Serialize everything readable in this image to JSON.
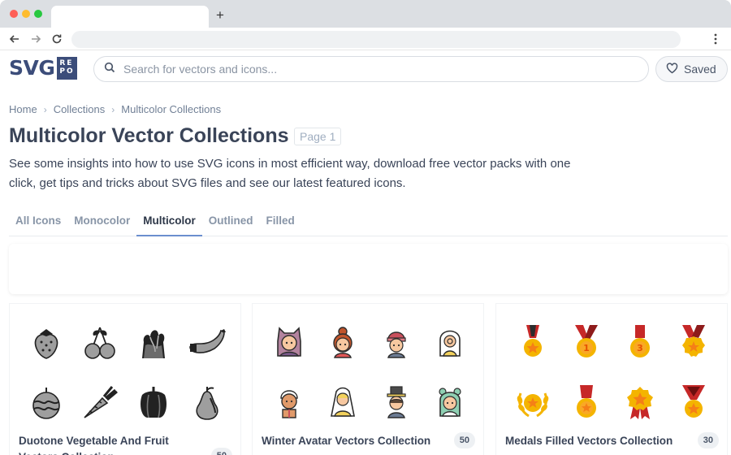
{
  "browser": {
    "new_tab": "+"
  },
  "header": {
    "logo_main": "SVG",
    "logo_sub": "REPO",
    "search_placeholder": "Search for vectors and icons...",
    "saved_label": "Saved"
  },
  "breadcrumb": [
    "Home",
    "Collections",
    "Multicolor Collections"
  ],
  "page": {
    "title": "Multicolor Vector Collections",
    "page_badge": "Page 1",
    "description": "See some insights into how to use SVG icons in most efficient way, download free vector packs with one click, get tips and tricks about SVG files and see our latest featured icons."
  },
  "tabs": [
    {
      "label": "All Icons",
      "active": false
    },
    {
      "label": "Monocolor",
      "active": false
    },
    {
      "label": "Multicolor",
      "active": true
    },
    {
      "label": "Outlined",
      "active": false
    },
    {
      "label": "Filled",
      "active": false
    }
  ],
  "collections": [
    {
      "title": "Duotone Vegetable And Fruit Vectors Collection",
      "count": "50",
      "icons": [
        "strawberry-icon",
        "cherry-icon",
        "lettuce-icon",
        "banana-icon",
        "melon-icon",
        "carrot-icon",
        "pepper-icon",
        "pear-icon"
      ]
    },
    {
      "title": "Winter Avatar Vectors Collection",
      "count": "50",
      "icons": [
        "cat-hood-avatar-icon",
        "bun-hair-avatar-icon",
        "beanie-avatar-icon",
        "hooded-avatar-icon",
        "gingerbread-avatar-icon",
        "hooded-girl-avatar-icon",
        "top-hat-avatar-icon",
        "bear-hood-avatar-icon"
      ]
    },
    {
      "title": "Medals Filled Vectors Collection",
      "count": "30",
      "icons": [
        "medal-star-icon",
        "medal-one-icon",
        "medal-three-icon",
        "medal-badge-icon",
        "laurel-medal-icon",
        "medal-star-icon-2",
        "medal-rosette-icon",
        "medal-ribbon-icon"
      ]
    }
  ],
  "colors": {
    "accent": "#6b8fcf",
    "logo": "#3c4d7a",
    "medal_gold": "#f4b400",
    "medal_red": "#d32f2f"
  }
}
